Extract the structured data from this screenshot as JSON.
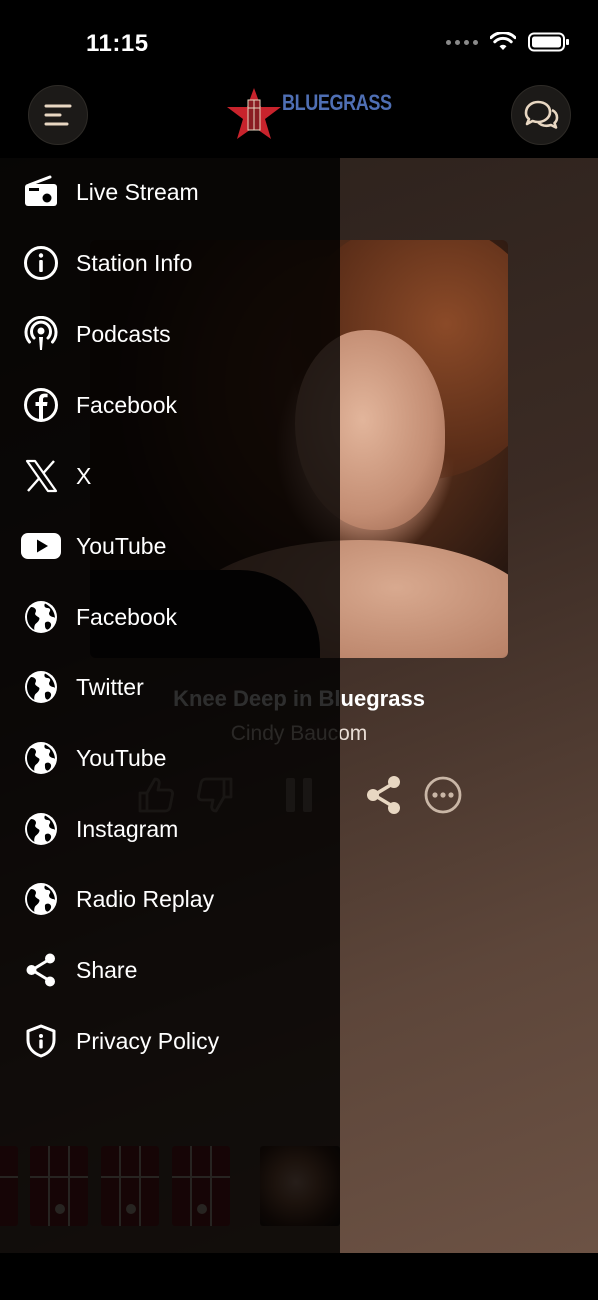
{
  "status_bar": {
    "time": "11:15"
  },
  "header": {
    "logo_text": "BLUEGRASS",
    "menu_icon": "hamburger-menu-icon",
    "chat_icon": "chat-bubbles-icon",
    "accent_color": "#4f6fb4",
    "star_color": "#c8232c"
  },
  "player": {
    "title": "Knee Deep in Bluegrass",
    "artist": "Cindy Baucom",
    "controls": [
      "thumbs-up-icon",
      "thumbs-down-icon",
      "pause-icon",
      "share-icon",
      "more-icon"
    ],
    "control_color": "#e8d7c2"
  },
  "drawer": {
    "items": [
      {
        "label": "Live Stream",
        "icon": "radio-icon"
      },
      {
        "label": "Station Info",
        "icon": "info-icon"
      },
      {
        "label": "Podcasts",
        "icon": "podcast-icon"
      },
      {
        "label": "Facebook",
        "icon": "facebook-icon"
      },
      {
        "label": "X",
        "icon": "x-logo-icon"
      },
      {
        "label": "YouTube",
        "icon": "youtube-icon"
      },
      {
        "label": "Facebook",
        "icon": "globe-icon"
      },
      {
        "label": "Twitter",
        "icon": "globe-icon"
      },
      {
        "label": "YouTube",
        "icon": "globe-icon"
      },
      {
        "label": "Instagram",
        "icon": "globe-icon"
      },
      {
        "label": "Radio Replay",
        "icon": "globe-icon"
      },
      {
        "label": "Share",
        "icon": "share-icon"
      },
      {
        "label": "Privacy Policy",
        "icon": "shield-icon"
      }
    ]
  }
}
